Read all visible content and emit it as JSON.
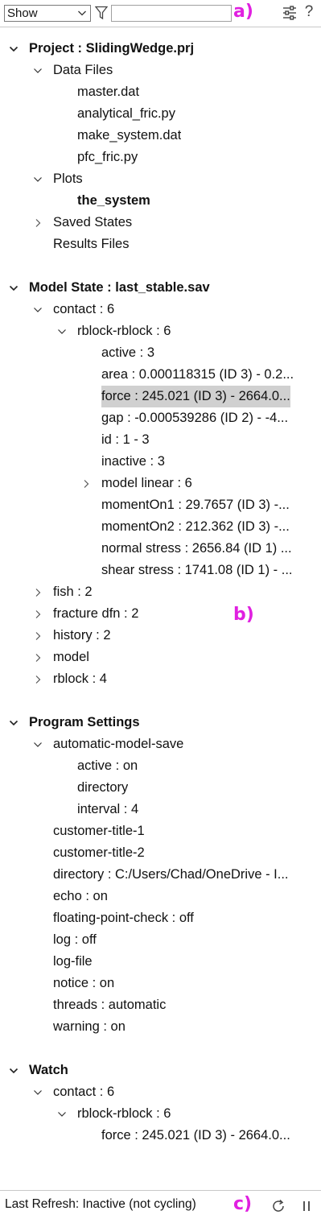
{
  "toolbar": {
    "show_value": "Show",
    "filter_value": "",
    "annotation": "a)"
  },
  "tree": [
    {
      "label": "Project :  SlidingWedge.prj",
      "level": 0,
      "expand": "open",
      "bold": true
    },
    {
      "label": "Data Files",
      "level": 1,
      "expand": "open"
    },
    {
      "label": "master.dat",
      "level": 2
    },
    {
      "label": "analytical_fric.py",
      "level": 2
    },
    {
      "label": "make_system.dat",
      "level": 2
    },
    {
      "label": "pfc_fric.py",
      "level": 2
    },
    {
      "label": "Plots",
      "level": 1,
      "expand": "open"
    },
    {
      "label": "the_system",
      "level": 2,
      "bold": true
    },
    {
      "label": "Saved States",
      "level": 1,
      "expand": "closed"
    },
    {
      "label": "Results Files",
      "level": 1
    },
    {
      "label": "",
      "level": 0,
      "spacer": true
    },
    {
      "label": "Model State :  last_stable.sav",
      "level": 0,
      "expand": "open",
      "bold": true
    },
    {
      "label": "contact :  6",
      "level": 1,
      "expand": "open"
    },
    {
      "label": "rblock-rblock :  6",
      "level": 2,
      "expand": "open"
    },
    {
      "label": "active :  3",
      "level": 3
    },
    {
      "label": "area :  0.000118315 (ID 3) - 0.2...",
      "level": 3
    },
    {
      "label": "force :  245.021 (ID 3) - 2664.0...",
      "level": 3,
      "selected": true
    },
    {
      "label": "gap :  -0.000539286 (ID 2) - -4...",
      "level": 3
    },
    {
      "label": "id :  1 - 3",
      "level": 3
    },
    {
      "label": "inactive :  3",
      "level": 3
    },
    {
      "label": "model linear :  6",
      "level": 3,
      "expand": "closed"
    },
    {
      "label": "momentOn1 :  29.7657 (ID 3) -...",
      "level": 3
    },
    {
      "label": "momentOn2 :  212.362 (ID 3) -...",
      "level": 3
    },
    {
      "label": "normal stress :  2656.84 (ID 1) ...",
      "level": 3
    },
    {
      "label": "shear stress :  1741.08 (ID 1) - ...",
      "level": 3
    },
    {
      "label": "fish :  2",
      "level": 1,
      "expand": "closed"
    },
    {
      "label": "fracture dfn :  2",
      "level": 1,
      "expand": "closed"
    },
    {
      "label": "history :  2",
      "level": 1,
      "expand": "closed"
    },
    {
      "label": "model",
      "level": 1,
      "expand": "closed"
    },
    {
      "label": "rblock :  4",
      "level": 1,
      "expand": "closed"
    },
    {
      "label": "",
      "level": 0,
      "spacer": true
    },
    {
      "label": "Program Settings",
      "level": 0,
      "expand": "open",
      "bold": true
    },
    {
      "label": "automatic-model-save",
      "level": 1,
      "expand": "open"
    },
    {
      "label": "active :  on",
      "level": 2
    },
    {
      "label": "directory",
      "level": 2
    },
    {
      "label": "interval :  4",
      "level": 2
    },
    {
      "label": "customer-title-1",
      "level": 1
    },
    {
      "label": "customer-title-2",
      "level": 1
    },
    {
      "label": "directory :  C:/Users/Chad/OneDrive - I...",
      "level": 1
    },
    {
      "label": "echo :  on",
      "level": 1
    },
    {
      "label": "floating-point-check :  off",
      "level": 1
    },
    {
      "label": "log :  off",
      "level": 1
    },
    {
      "label": "log-file",
      "level": 1
    },
    {
      "label": "notice :  on",
      "level": 1
    },
    {
      "label": "threads :  automatic",
      "level": 1
    },
    {
      "label": "warning :  on",
      "level": 1
    },
    {
      "label": "",
      "level": 0,
      "spacer": true
    },
    {
      "label": "Watch",
      "level": 0,
      "expand": "open",
      "bold": true
    },
    {
      "label": "contact :  6",
      "level": 1,
      "expand": "open"
    },
    {
      "label": "rblock-rblock :  6",
      "level": 2,
      "expand": "open"
    },
    {
      "label": "force :  245.021 (ID 3) - 2664.0...",
      "level": 3
    }
  ],
  "tree_annotation": "b)",
  "status": {
    "text": "Last Refresh: Inactive (not cycling)",
    "annotation": "c)"
  },
  "colors": {
    "annotation": "#e020e0",
    "selection": "#d0d0d0"
  }
}
